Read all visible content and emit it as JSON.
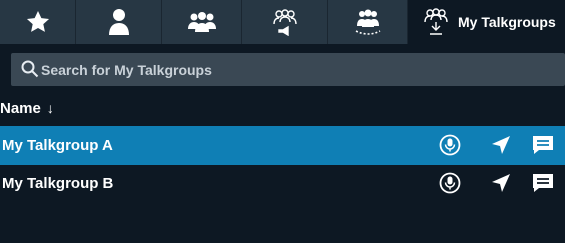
{
  "tabs": [
    {
      "icon": "star-icon"
    },
    {
      "icon": "user-icon"
    },
    {
      "icon": "group-icon"
    },
    {
      "icon": "talkgroup-broadcast-icon"
    },
    {
      "icon": "talkgroup-scan-icon"
    },
    {
      "icon": "talkgroup-download-icon",
      "label": "My Talkgroups"
    }
  ],
  "search": {
    "placeholder": "Search for My Talkgroups",
    "value": ""
  },
  "list": {
    "header": "Name",
    "sort_icon": "arrow-down-icon",
    "rows": [
      {
        "name": "My Talkgroup A",
        "selected": true
      },
      {
        "name": "My Talkgroup B",
        "selected": false
      }
    ]
  },
  "colors": {
    "accent": "#0f7fb5",
    "background": "#0d1823",
    "tabbar": "#273744",
    "search_bg": "#3a4854"
  }
}
